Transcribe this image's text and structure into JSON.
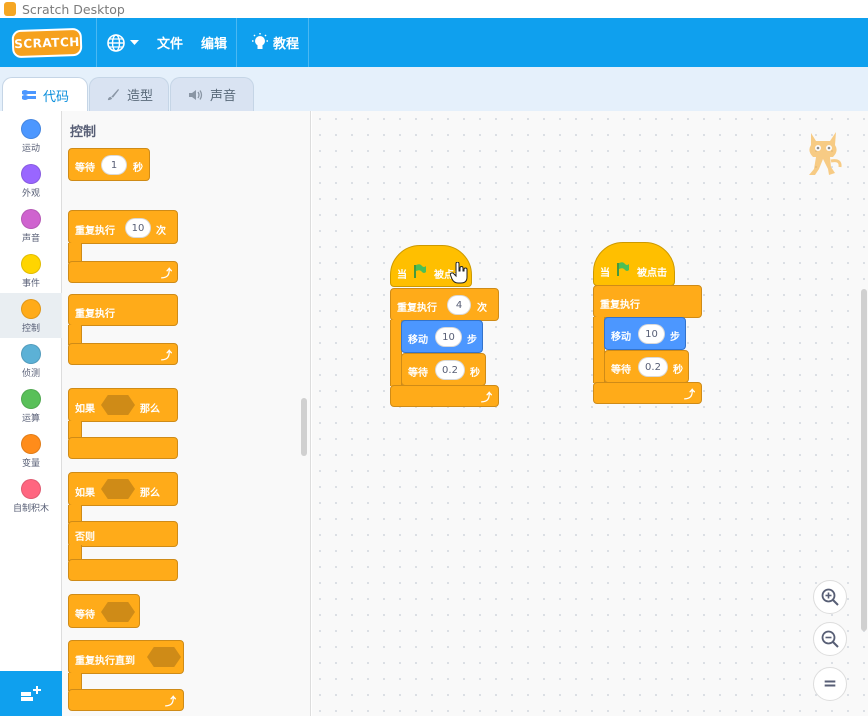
{
  "window": {
    "title": "Scratch Desktop"
  },
  "menubar": {
    "logo_text": "SCRATCH",
    "file_label": "文件",
    "edit_label": "编辑",
    "tutorials_label": "教程",
    "brand_color": "#0FA0EE"
  },
  "tabs": [
    {
      "label": "代码",
      "active": true,
      "icon": "code-icon"
    },
    {
      "label": "造型",
      "active": false,
      "icon": "brush-icon"
    },
    {
      "label": "声音",
      "active": false,
      "icon": "speaker-icon"
    }
  ],
  "categories": [
    {
      "label": "运动",
      "color": "#4C97FF"
    },
    {
      "label": "外观",
      "color": "#9966FF"
    },
    {
      "label": "声音",
      "color": "#CF63CF"
    },
    {
      "label": "事件",
      "color": "#FFD500"
    },
    {
      "label": "控制",
      "color": "#FFAB19",
      "active": true
    },
    {
      "label": "侦测",
      "color": "#5CB1D6"
    },
    {
      "label": "运算",
      "color": "#59C059"
    },
    {
      "label": "变量",
      "color": "#FF8C1A"
    },
    {
      "label": "自制积木",
      "color": "#FF6680"
    }
  ],
  "palette": {
    "title": "控制",
    "wait": {
      "label": "等待",
      "value": "1",
      "unit": "秒"
    },
    "repeat": {
      "label": "重复执行",
      "value": "10",
      "unit": "次"
    },
    "forever": {
      "label": "重复执行"
    },
    "if_then": {
      "label": "如果",
      "then": "那么"
    },
    "if_else": {
      "label": "如果",
      "then": "那么",
      "else": "否则"
    },
    "wait_until": {
      "label": "等待"
    },
    "repeat_until": {
      "label": "重复执行直到"
    }
  },
  "scripts": [
    {
      "hat": {
        "label": "当",
        "suffix": "被点击"
      },
      "repeat": {
        "label": "重复执行",
        "value": "4",
        "unit": "次"
      },
      "move": {
        "label": "移动",
        "value": "10",
        "unit": "步"
      },
      "wait": {
        "label": "等待",
        "value": "0.2",
        "unit": "秒"
      }
    },
    {
      "hat": {
        "label": "当",
        "suffix": "被点击"
      },
      "forever": {
        "label": "重复执行"
      },
      "move": {
        "label": "移动",
        "value": "10",
        "unit": "步"
      },
      "wait": {
        "label": "等待",
        "value": "0.2",
        "unit": "秒"
      }
    }
  ],
  "zoom": {
    "in": "zoom-in-icon",
    "out": "zoom-out-icon",
    "reset": "="
  }
}
